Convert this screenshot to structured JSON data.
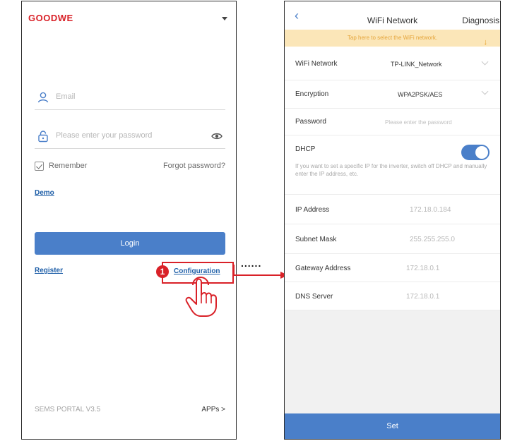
{
  "login": {
    "brand": "GOODWE",
    "email_placeholder": "Email",
    "password_placeholder": "Please enter your password",
    "remember_label": "Remember",
    "forgot_label": "Forgot password?",
    "demo_label": "Demo",
    "login_label": "Login",
    "register_label": "Register",
    "configuration_label": "Configuration",
    "step_number": "1",
    "version": "SEMS PORTAL V3.5",
    "apps_label": "APPs >"
  },
  "connector": {
    "dots": "......"
  },
  "wifi": {
    "title": "WiFi Network",
    "diagnosis_label": "Diagnosis",
    "hint": "Tap here to select the WiFi network.",
    "rows": [
      {
        "label": "WiFi Network",
        "value": "TP-LINK_Network"
      },
      {
        "label": "Encryption",
        "value": "WPA2PSK/AES"
      },
      {
        "label": "Password",
        "value": "Please enter the password"
      },
      {
        "label": "DHCP",
        "value": "If you want to set a specific IP for the inverter, switch off DHCP and manually enter the IP address, etc."
      },
      {
        "label": "IP Address",
        "value": "172.18.0.184"
      },
      {
        "label": "Subnet Mask",
        "value": "255.255.255.0"
      },
      {
        "label": "Gateway Address",
        "value": "172.18.0.1"
      },
      {
        "label": "DNS Server",
        "value": "172.18.0.1"
      }
    ],
    "set_label": "Set"
  },
  "colors": {
    "brand_red": "#d92128",
    "primary_blue": "#4a7fc9",
    "link_blue": "#1f5fa8",
    "hint_bg": "#fbe6b8",
    "hint_text": "#e5a53b"
  },
  "icons": [
    "user-icon",
    "lock-icon",
    "eye-icon",
    "checkbox-icon",
    "chevron-down-icon",
    "back-arrow-icon",
    "pointing-hand-icon",
    "toggle-switch"
  ]
}
